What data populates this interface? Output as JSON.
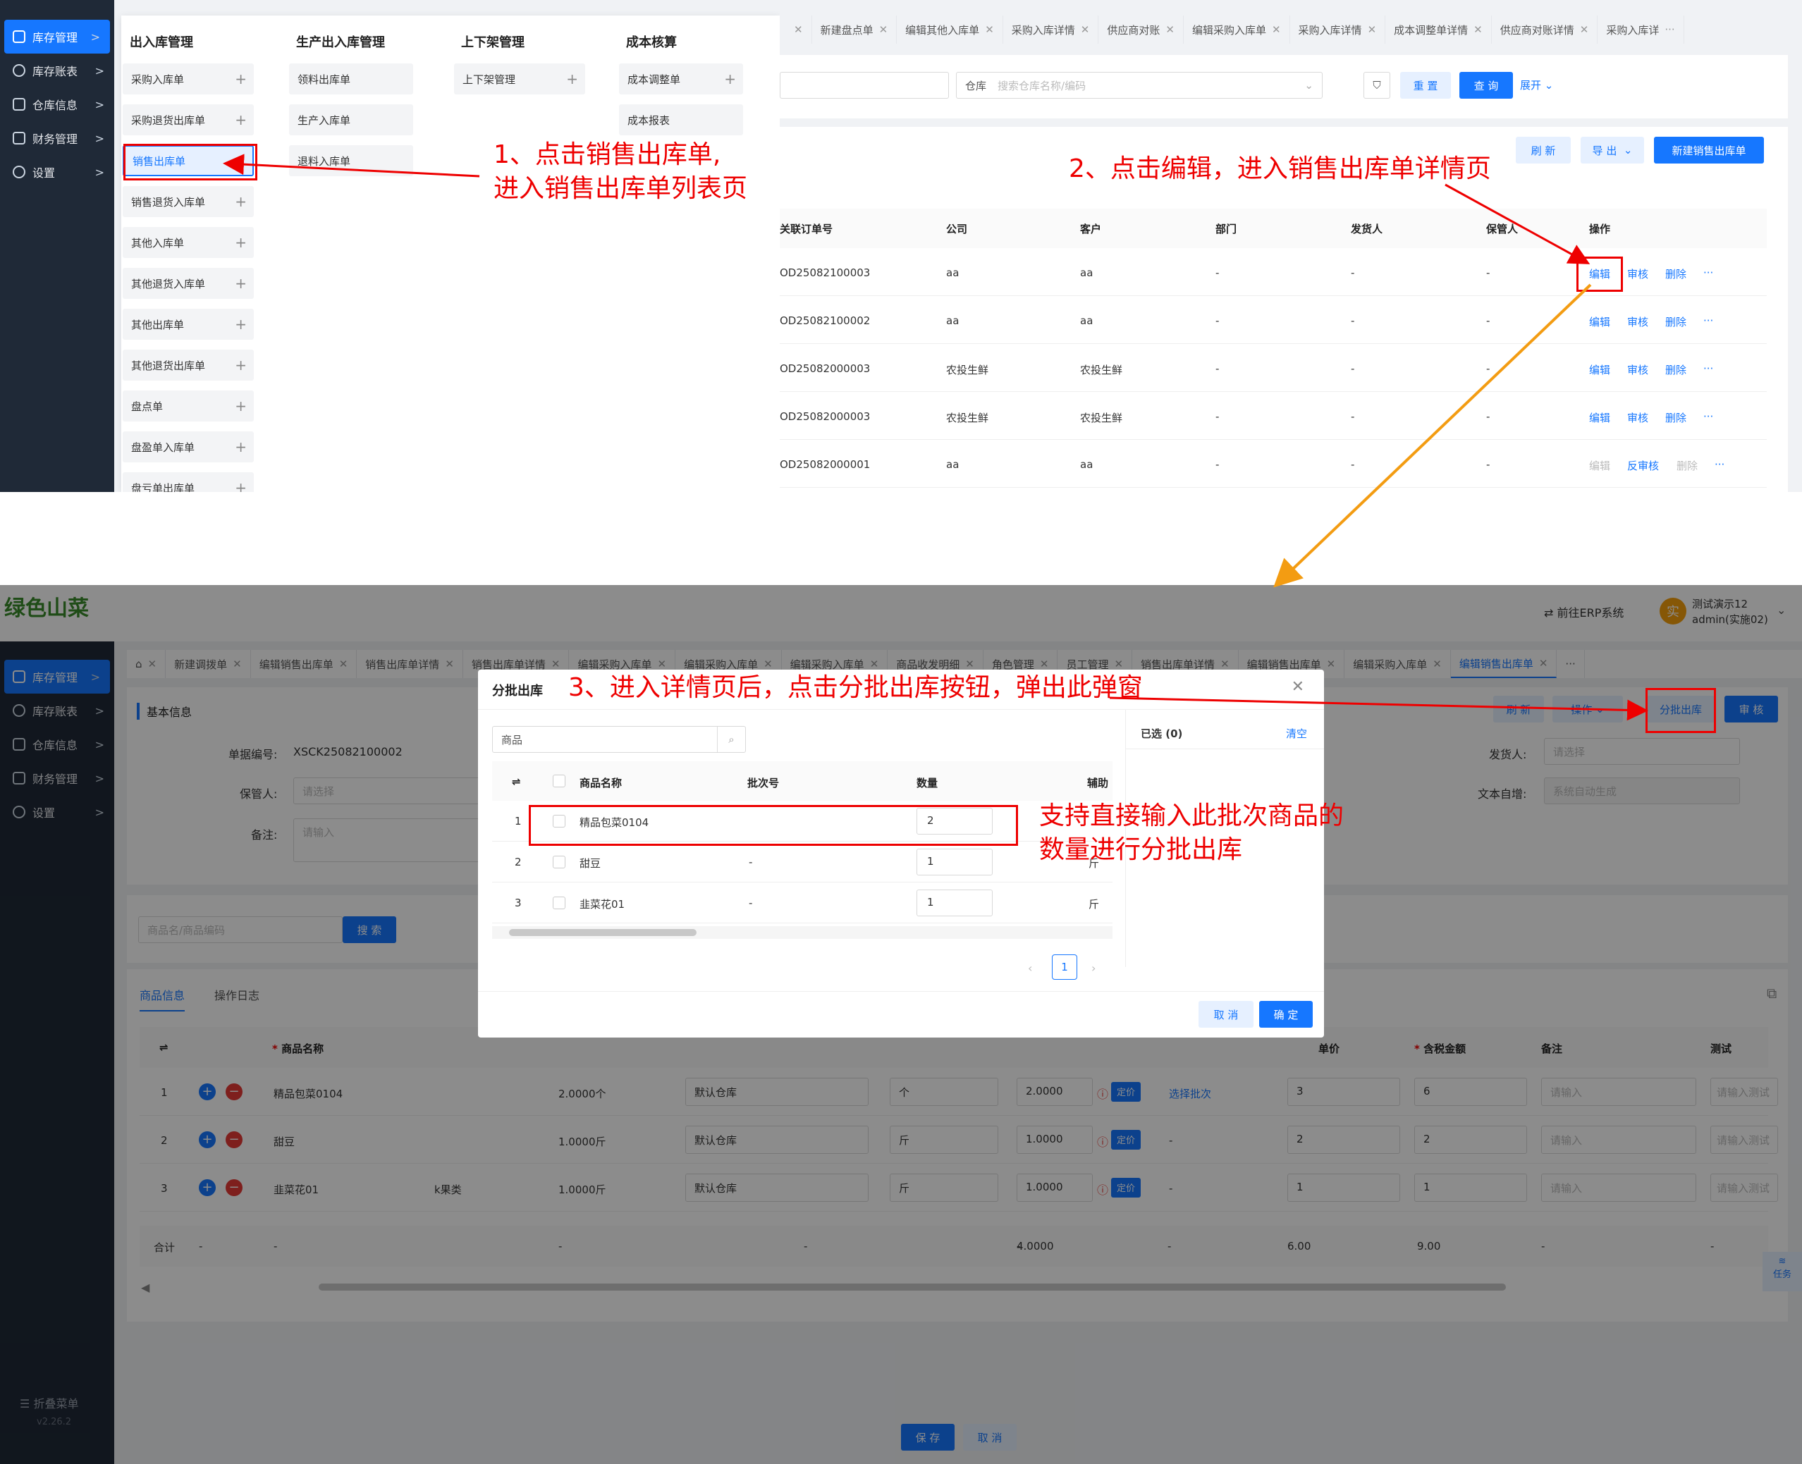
{
  "sidebar": {
    "items": [
      {
        "label": "库存管理"
      },
      {
        "label": "库存账表"
      },
      {
        "label": "仓库信息"
      },
      {
        "label": "财务管理"
      },
      {
        "label": "设置"
      }
    ],
    "collapse_label": "折叠菜单",
    "version": "v2.26.2"
  },
  "menu": {
    "col1": {
      "title": "出入库管理",
      "items": [
        "采购入库单",
        "采购退货出库单",
        "销售出库单",
        "销售退货入库单",
        "其他入库单",
        "其他退货入库单",
        "其他出库单",
        "其他退货出库单",
        "盘点单",
        "盘盈单入库单",
        "盘亏单出库单"
      ]
    },
    "col2": {
      "title": "生产出入库管理",
      "items": [
        "领料出库单",
        "生产入库单",
        "退料入库单"
      ]
    },
    "col3": {
      "title": "上下架管理",
      "items": [
        "上下架管理"
      ]
    },
    "col4": {
      "title": "成本核算",
      "items": [
        "成本调整单",
        "成本报表"
      ]
    }
  },
  "tabs_top": [
    "新建盘点单",
    "编辑其他入库单",
    "采购入库详情",
    "供应商对账",
    "编辑采购入库单",
    "采购入库详情",
    "成本调整单详情",
    "供应商对账详情",
    "采购入库详"
  ],
  "list": {
    "warehouse_label": "仓库",
    "warehouse_placeholder": "搜索仓库名称/编码",
    "reset": "重 置",
    "query": "查 询",
    "expand": "展开",
    "refresh": "刷 新",
    "export": "导 出",
    "new": "新建销售出库单",
    "headers": [
      "关联订单号",
      "公司",
      "客户",
      "部门",
      "发货人",
      "保管人",
      "操作"
    ],
    "rows": [
      {
        "order": "OD25082100003",
        "company": "aa",
        "customer": "aa",
        "dept": "-",
        "shipper": "-",
        "keeper": "-",
        "ops": [
          "编辑",
          "审核",
          "删除",
          "···"
        ]
      },
      {
        "order": "OD25082100002",
        "company": "aa",
        "customer": "aa",
        "dept": "-",
        "shipper": "-",
        "keeper": "-",
        "ops": [
          "编辑",
          "审核",
          "删除",
          "···"
        ]
      },
      {
        "order": "OD25082000003",
        "company": "农投生鲜",
        "customer": "农投生鲜",
        "dept": "-",
        "shipper": "-",
        "keeper": "-",
        "ops": [
          "编辑",
          "审核",
          "删除",
          "···"
        ]
      },
      {
        "order": "OD25082000003",
        "company": "农投生鲜",
        "customer": "农投生鲜",
        "dept": "-",
        "shipper": "-",
        "keeper": "-",
        "ops": [
          "编辑",
          "审核",
          "删除",
          "···"
        ]
      },
      {
        "order": "OD25082000001",
        "company": "aa",
        "customer": "aa",
        "dept": "-",
        "shipper": "-",
        "keeper": "-",
        "ops": [
          "编辑",
          "反审核",
          "删除",
          "···"
        ]
      }
    ]
  },
  "annotations": {
    "a1_line1": "1、点击销售出库单,",
    "a1_line2": "进入销售出库单列表页",
    "a2": "2、点击编辑，进入销售出库单详情页",
    "a3": "3、进入详情页后，点击分批出库按钮，弹出此弹窗",
    "a4_line1": "支持直接输入此批次商品的",
    "a4_line2": "数量进行分批出库"
  },
  "detail": {
    "logo_text": "绿色山菜",
    "goto_erp": "前往ERP系统",
    "user_name": "测试演示12",
    "user_sub": "admin(实施02)",
    "avatar_char": "实",
    "tabs": [
      "新建调拨单",
      "编辑销售出库单",
      "销售出库单详情",
      "销售出库单详情",
      "编辑采购入库单",
      "编辑采购入库单",
      "编辑采购入库单",
      "商品收发明细",
      "角色管理",
      "员工管理",
      "销售出库单详情",
      "编辑销售出库单",
      "编辑采购入库单",
      "编辑销售出库单"
    ],
    "section_title": "基本信息",
    "doc_no_label": "单据编号:",
    "doc_no": "XSCK25082100002",
    "keeper_label": "保管人:",
    "keeper_placeholder": "请选择",
    "remark_label": "备注:",
    "remark_placeholder": "请输入",
    "shipper_label": "发货人:",
    "shipper_placeholder": "请选择",
    "text_label": "文本自增:",
    "text_placeholder": "系统自动生成",
    "btn_refresh": "刷 新",
    "btn_ops": "操作",
    "btn_batch": "分批出库",
    "btn_audit": "审 核",
    "search_placeholder": "商品名/商品编码",
    "search_btn": "搜 索",
    "tab_goods": "商品信息",
    "tab_log": "操作日志",
    "table_headers": [
      "商品名称",
      "单价",
      "含税金额",
      "备注",
      "测试"
    ],
    "rows": [
      {
        "idx": "1",
        "name": "精品包菜0104",
        "cat": "",
        "qty": "2.0000个",
        "wh": "默认仓库",
        "unit": "个",
        "num": "2.0000",
        "price_tag": "定价",
        "batch": "选择批次",
        "price": "3",
        "amount": "6",
        "remark": "请输入",
        "test": "请输入测试"
      },
      {
        "idx": "2",
        "name": "甜豆",
        "cat": "",
        "qty": "1.0000斤",
        "wh": "默认仓库",
        "unit": "斤",
        "num": "1.0000",
        "price_tag": "定价",
        "batch": "-",
        "price": "2",
        "amount": "2",
        "remark": "请输入",
        "test": "请输入测试"
      },
      {
        "idx": "3",
        "name": "韭菜花01",
        "cat": "k果类",
        "qty": "1.0000斤",
        "wh": "默认仓库",
        "unit": "斤",
        "num": "1.0000",
        "price_tag": "定价",
        "batch": "-",
        "price": "1",
        "amount": "1",
        "remark": "请输入",
        "test": "请输入测试"
      }
    ],
    "total_label": "合计",
    "total_dash": "-",
    "total_num": "4.0000",
    "total_price": "6.00",
    "total_amount": "9.00",
    "save": "保 存",
    "cancel": "取 消",
    "task": "任务"
  },
  "modal": {
    "title": "分批出库",
    "search_placeholder": "商品",
    "selected_label": "已选 (0)",
    "clear": "清空",
    "headers": [
      "商品名称",
      "批次号",
      "数量",
      "辅助"
    ],
    "rows": [
      {
        "idx": "1",
        "name": "精品包菜0104",
        "batch": "",
        "qty": "2",
        "unit": ""
      },
      {
        "idx": "2",
        "name": "甜豆",
        "batch": "-",
        "qty": "1",
        "unit": "斤"
      },
      {
        "idx": "3",
        "name": "韭菜花01",
        "batch": "-",
        "qty": "1",
        "unit": "斤"
      }
    ],
    "page": "1",
    "cancel": "取 消",
    "confirm": "确 定"
  }
}
